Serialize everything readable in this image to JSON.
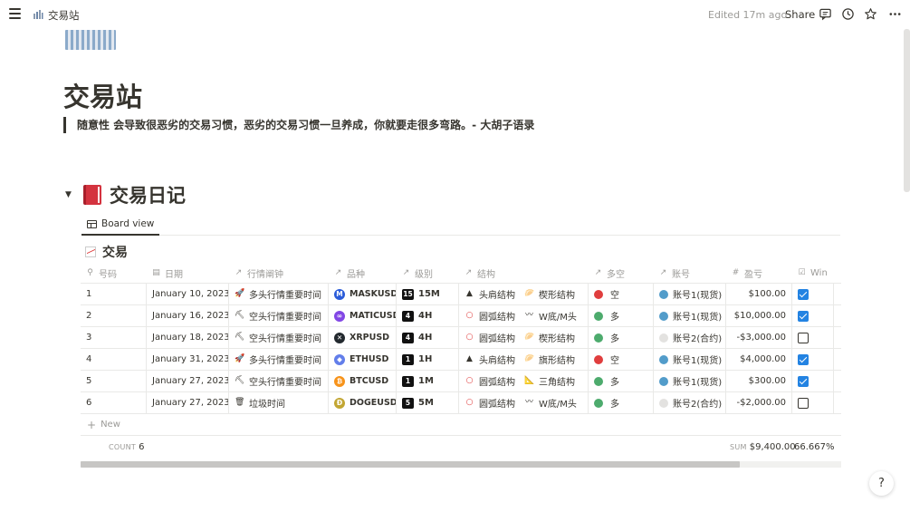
{
  "topbar": {
    "breadcrumb": "交易站",
    "edited": "Edited 17m ago",
    "share": "Share"
  },
  "page": {
    "title": "交易站",
    "quote": "随意性 会导致很恶劣的交易习惯，恶劣的交易习惯一旦养成，你就要走很多弯路。-  大胡子语录"
  },
  "section": {
    "heading": "交易日记",
    "view_tab": "Board view"
  },
  "database": {
    "title": "交易",
    "columns": [
      "号码",
      "日期",
      "行情阐钟",
      "品种",
      "级别",
      "结构",
      "多空",
      "账号",
      "盈亏",
      "Win"
    ],
    "column_icons": [
      "pin-icon",
      "calendar-icon",
      "relation-arrow-icon",
      "relation-arrow-icon",
      "relation-arrow-icon",
      "relation-arrow-icon",
      "relation-arrow-icon",
      "relation-arrow-icon",
      "number-icon",
      "checkbox-icon"
    ],
    "rows": [
      {
        "num": "1",
        "date": "January 10, 2023",
        "market_icon": "🚀",
        "market": "多头行情重要时间",
        "coin": "MASKUSD",
        "coin_color": "#2b5cd9",
        "coin_glyph": "M",
        "level_badge": "15",
        "level": "15M",
        "s1_icon": "▲",
        "s1": "头肩结构",
        "s2_icon": "🥟",
        "s2": "楔形结构",
        "dir_color": "#e03e3e",
        "dir": "空",
        "acct_color": "#529cca",
        "acct": "账号1(现货)",
        "pnl": "$100.00",
        "win": true
      },
      {
        "num": "2",
        "date": "January 16, 2023",
        "market_icon": "⛏",
        "market": "空头行情重要时间",
        "coin": "MATICUSD",
        "coin_color": "#8247e5",
        "coin_glyph": "∞",
        "level_badge": "4",
        "level": "4H",
        "s1_icon": "○",
        "s1": "圆弧结构",
        "s2_icon": "〰",
        "s2": "W底/M头",
        "dir_color": "#4dab6d",
        "dir": "多",
        "acct_color": "#529cca",
        "acct": "账号1(现货)",
        "pnl": "$10,000.00",
        "win": true
      },
      {
        "num": "3",
        "date": "January 18, 2023",
        "market_icon": "⛏",
        "market": "空头行情重要时间",
        "coin": "XRPUSD",
        "coin_color": "#23292f",
        "coin_glyph": "✕",
        "level_badge": "4",
        "level": "4H",
        "s1_icon": "○",
        "s1": "圆弧结构",
        "s2_icon": "🥟",
        "s2": "楔形结构",
        "dir_color": "#4dab6d",
        "dir": "多",
        "acct_color": "#e3e2e0",
        "acct": "账号2(合约)",
        "pnl": "-$3,000.00",
        "win": false
      },
      {
        "num": "4",
        "date": "January 31, 2023",
        "market_icon": "🚀",
        "market": "多头行情重要时间",
        "coin": "ETHUSD",
        "coin_color": "#627eea",
        "coin_glyph": "◆",
        "level_badge": "1",
        "level": "1H",
        "s1_icon": "▲",
        "s1": "头肩结构",
        "s2_icon": "🥟",
        "s2": "旗形结构",
        "dir_color": "#e03e3e",
        "dir": "空",
        "acct_color": "#529cca",
        "acct": "账号1(现货)",
        "pnl": "$4,000.00",
        "win": true
      },
      {
        "num": "5",
        "date": "January 27, 2023",
        "market_icon": "⛏",
        "market": "空头行情重要时间",
        "coin": "BTCUSD",
        "coin_color": "#f7931a",
        "coin_glyph": "₿",
        "level_badge": "1",
        "level": "1M",
        "s1_icon": "○",
        "s1": "圆弧结构",
        "s2_icon": "📐",
        "s2": "三角结构",
        "dir_color": "#4dab6d",
        "dir": "多",
        "acct_color": "#529cca",
        "acct": "账号1(现货)",
        "pnl": "$300.00",
        "win": true
      },
      {
        "num": "6",
        "date": "January 27, 2023",
        "market_icon": "🗑",
        "market": "垃圾时间",
        "coin": "DOGEUSD",
        "coin_color": "#c2a633",
        "coin_glyph": "Đ",
        "level_badge": "5",
        "level": "5M",
        "s1_icon": "○",
        "s1": "圆弧结构",
        "s2_icon": "〰",
        "s2": "W底/M头",
        "dir_color": "#4dab6d",
        "dir": "多",
        "acct_color": "#e3e2e0",
        "acct": "账号2(合约)",
        "pnl": "-$2,000.00",
        "win": false
      }
    ],
    "new_label": "New",
    "count_label": "COUNT",
    "count_value": "6",
    "sum_label": "SUM",
    "sum_value": "$9,400.00",
    "win_pct": "66.667%"
  },
  "help": "?"
}
